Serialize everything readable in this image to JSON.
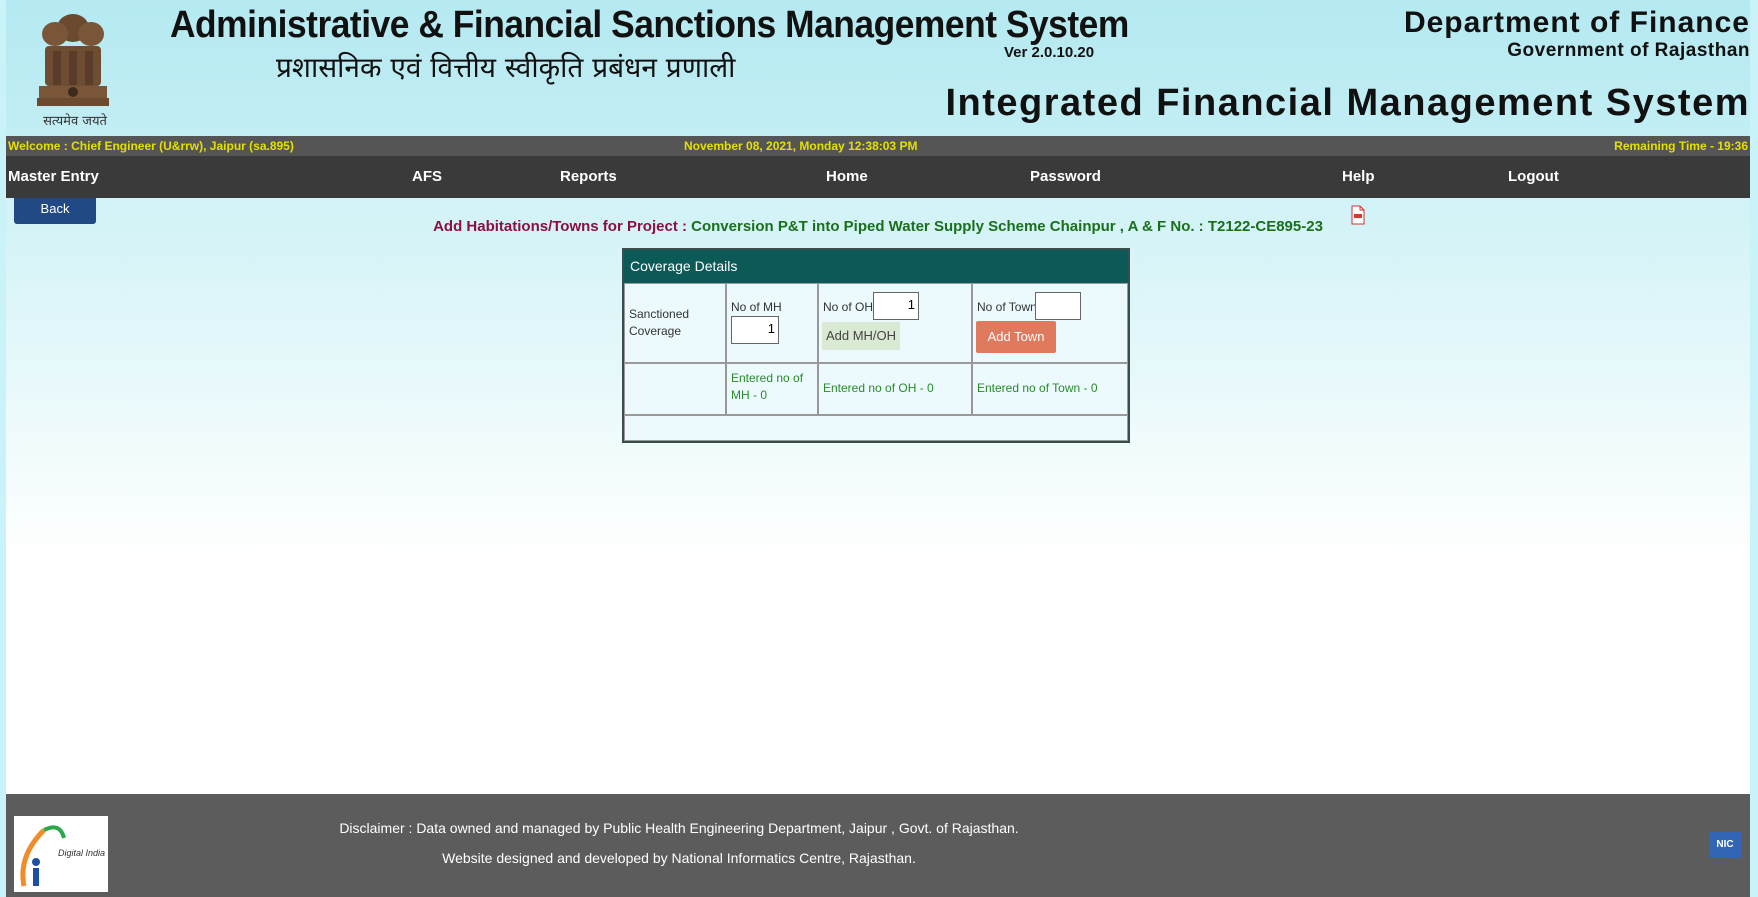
{
  "header": {
    "app_title": "Administrative & Financial Sanctions Management System",
    "version": "Ver 2.0.10.20",
    "app_title_hindi": "प्रशासनिक एवं वित्तीय स्वीकृति प्रबंधन प्रणाली",
    "emblem_motto": "सत्यमेव जयते",
    "department": "Department of Finance",
    "government": "Government of Rajasthan",
    "ifms": "Integrated Financial Management System"
  },
  "status": {
    "welcome": "Welcome : Chief Engineer (U&rrw), Jaipur (sa.895)",
    "datetime": "November 08, 2021, Monday 12:38:03 PM",
    "remaining": "Remaining Time - 19:36"
  },
  "menu": {
    "items": [
      "Master Entry",
      "AFS",
      "Reports",
      "Home",
      "Password",
      "Help",
      "Logout"
    ]
  },
  "back_label": "Back",
  "project": {
    "label": "Add Habitations/Towns for Project : ",
    "name": "Conversion P&T into Piped Water Supply Scheme Chainpur , A & F No. : T2122-CE895-23"
  },
  "coverage": {
    "title": "Coverage Details",
    "sanctioned_label": "Sanctioned Coverage",
    "mh_label": "No of MH",
    "mh_value": "1",
    "oh_label": "No of OH",
    "oh_value": "1",
    "town_label": "No of Town",
    "town_value": "",
    "add_mh_oh": "Add MH/OH",
    "add_town": "Add Town",
    "entered_mh": "Entered no of MH - 0",
    "entered_oh": "Entered no of OH - 0",
    "entered_town": "Entered no of Town - 0"
  },
  "footer": {
    "disclaimer": "Disclaimer : Data owned and managed by Public Health Engineering Department, Jaipur , Govt. of Rajasthan.",
    "designed_by": "Website designed and developed by National Informatics Centre, Rajasthan.",
    "nic": "NIC",
    "digital_india": "Digital India"
  },
  "colors": {
    "header_bg": "#b5e9f1",
    "menu_bg": "#3a3a3a",
    "status_text": "#e3e000",
    "coverage_header": "#0c5a57",
    "add_town_btn": "#e07a5f"
  }
}
